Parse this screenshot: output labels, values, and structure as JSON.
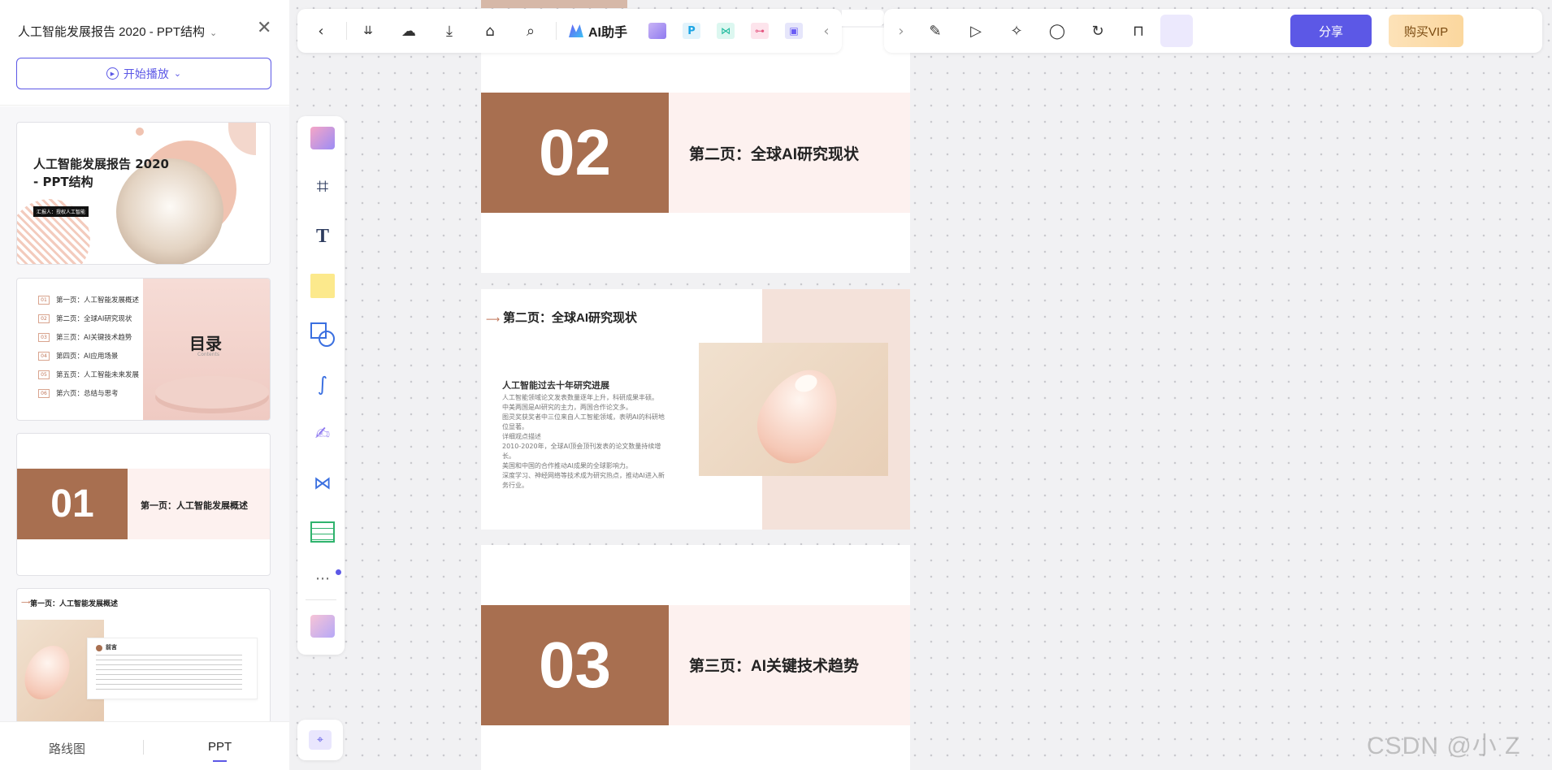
{
  "sidebar": {
    "doc_title": "人工智能发展报告 2020 - PPT结构",
    "play_button": "开始播放",
    "thumbs": {
      "t1_title_a": "人工智能发展报告 2020",
      "t1_title_b": "- PPT结构",
      "t1_tag": "汇报人：授权人工智能",
      "t2_heading": "目录",
      "t2_sub": "Contents",
      "t2_items": [
        {
          "num": "01",
          "label": "第一页：人工智能发展概述"
        },
        {
          "num": "02",
          "label": "第二页：全球AI研究现状"
        },
        {
          "num": "03",
          "label": "第三页：AI关键技术趋势"
        },
        {
          "num": "04",
          "label": "第四页：AI应用场景"
        },
        {
          "num": "05",
          "label": "第五页：人工智能未来发展"
        },
        {
          "num": "06",
          "label": "第六页：总结与思考"
        }
      ],
      "t3_num": "01",
      "t3_title": "第一页：人工智能发展概述",
      "t4_title": "第一页：人工智能发展概述",
      "t4_card_title": "前言"
    },
    "tabs": {
      "roadmap": "路线图",
      "ppt": "PPT"
    }
  },
  "toolbar": {
    "ai_label": "AI助手",
    "share_label": "分享",
    "vip_label": "购买VIP"
  },
  "canvas": {
    "slide_a": {
      "num": "02",
      "title": "第二页：全球AI研究现状"
    },
    "slide_b": {
      "title": "第二页：全球AI研究现状",
      "sub_title": "人工智能过去十年研究进展",
      "lines": [
        "人工智能领域论文发表数量逐年上升，科研成果丰硕。",
        "中美两国是AI研究的主力，两国合作论文多。",
        "图灵奖获奖者中三位来自人工智能领域，表明AI的科研地",
        "位显著。",
        "详细观点描述",
        "2010-2020年，全球AI顶会顶刊发表的论文数量持续增",
        "长。",
        "美国和中国的合作推动AI成果的全球影响力。",
        "深度学习、神经网络等技术成为研究热点，推动AI进入新",
        "务行业。"
      ]
    },
    "slide_c": {
      "num": "03",
      "title": "第三页：AI关键技术趋势"
    }
  },
  "watermark": "CSDN @小 Z",
  "colors": {
    "accent": "#5c58e6",
    "brown": "#a86f50",
    "pink": "#fdf1ef",
    "vip": "#fbd79e"
  }
}
